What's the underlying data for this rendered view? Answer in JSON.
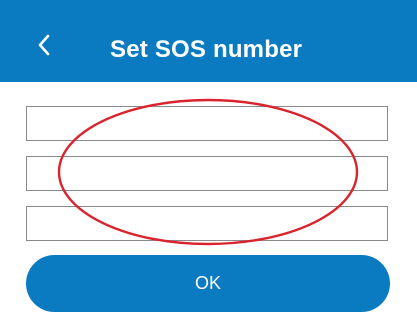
{
  "header": {
    "title": "Set SOS number",
    "back_icon": "chevron-left-icon"
  },
  "sos_fields": [
    {
      "value": "",
      "placeholder": ""
    },
    {
      "value": "",
      "placeholder": ""
    },
    {
      "value": "",
      "placeholder": ""
    }
  ],
  "ok_button": {
    "label": "OK"
  },
  "colors": {
    "accent": "#0a7bc1",
    "annotation": "#d9232d",
    "field_border": "#8a8a8a"
  }
}
